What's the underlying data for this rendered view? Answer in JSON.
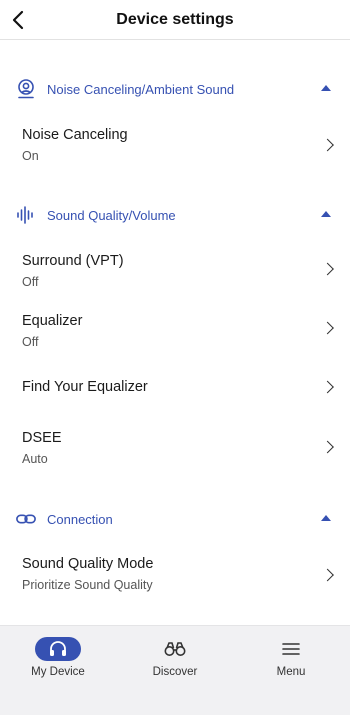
{
  "header": {
    "title": "Device settings"
  },
  "sections": [
    {
      "label": "Noise Canceling/Ambient Sound",
      "items": [
        {
          "label": "Noise Canceling",
          "value": "On"
        }
      ]
    },
    {
      "label": "Sound Quality/Volume",
      "items": [
        {
          "label": "Surround (VPT)",
          "value": "Off"
        },
        {
          "label": "Equalizer",
          "value": "Off"
        },
        {
          "label": "Find Your Equalizer",
          "value": ""
        },
        {
          "label": "DSEE",
          "value": "Auto"
        }
      ]
    },
    {
      "label": "Connection",
      "items": [
        {
          "label": "Sound Quality Mode",
          "value": "Prioritize Sound Quality"
        }
      ]
    }
  ],
  "bottom_nav": [
    {
      "label": "My Device",
      "icon": "headphones-icon",
      "active": true
    },
    {
      "label": "Discover",
      "icon": "binoculars-icon",
      "active": false
    },
    {
      "label": "Menu",
      "icon": "hamburger-icon",
      "active": false
    }
  ],
  "colors": {
    "accent": "#3651b2",
    "nav_bg": "#f1f1f3"
  }
}
